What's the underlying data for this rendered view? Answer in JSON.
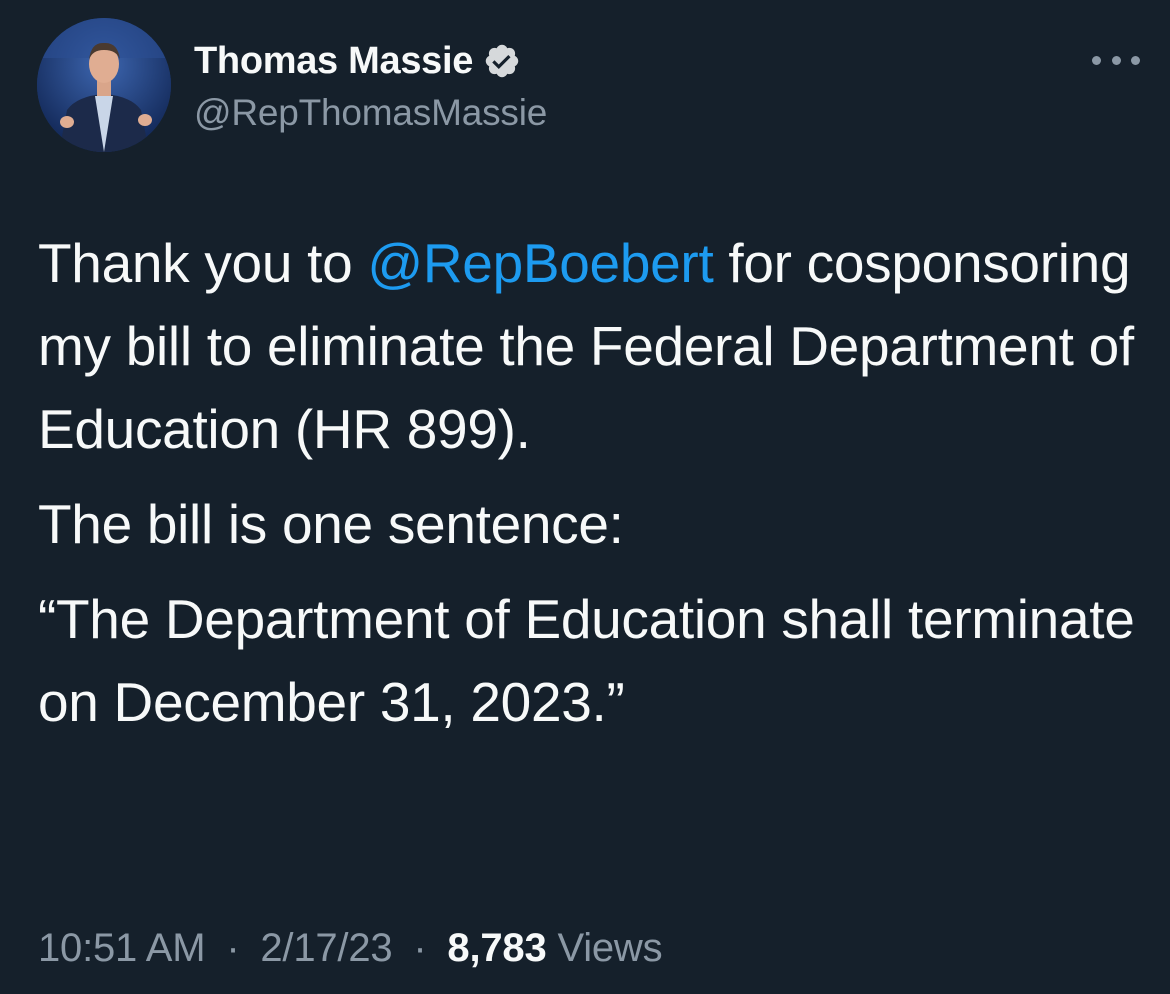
{
  "author": {
    "display_name": "Thomas Massie",
    "handle": "@RepThomasMassie",
    "verified": true
  },
  "icons": {
    "verified": "verified-badge-icon",
    "more": "more-horizontal-icon"
  },
  "colors": {
    "background": "#15202b",
    "text": "#f7f9f9",
    "secondary_text": "#8b98a5",
    "link": "#1d9bf0"
  },
  "tweet": {
    "line1_pre": "Thank you to ",
    "mention": "@RepBoebert",
    "line1_post": " for cosponsoring my bill to eliminate the Federal Department of Education (HR 899).",
    "paragraph2": "The bill is one sentence:",
    "paragraph3": "“The Department of Education shall terminate on December 31, 2023.”"
  },
  "meta": {
    "time": "10:51 AM",
    "separator": "·",
    "date": "2/17/23",
    "views_count": "8,783",
    "views_label": "Views"
  }
}
